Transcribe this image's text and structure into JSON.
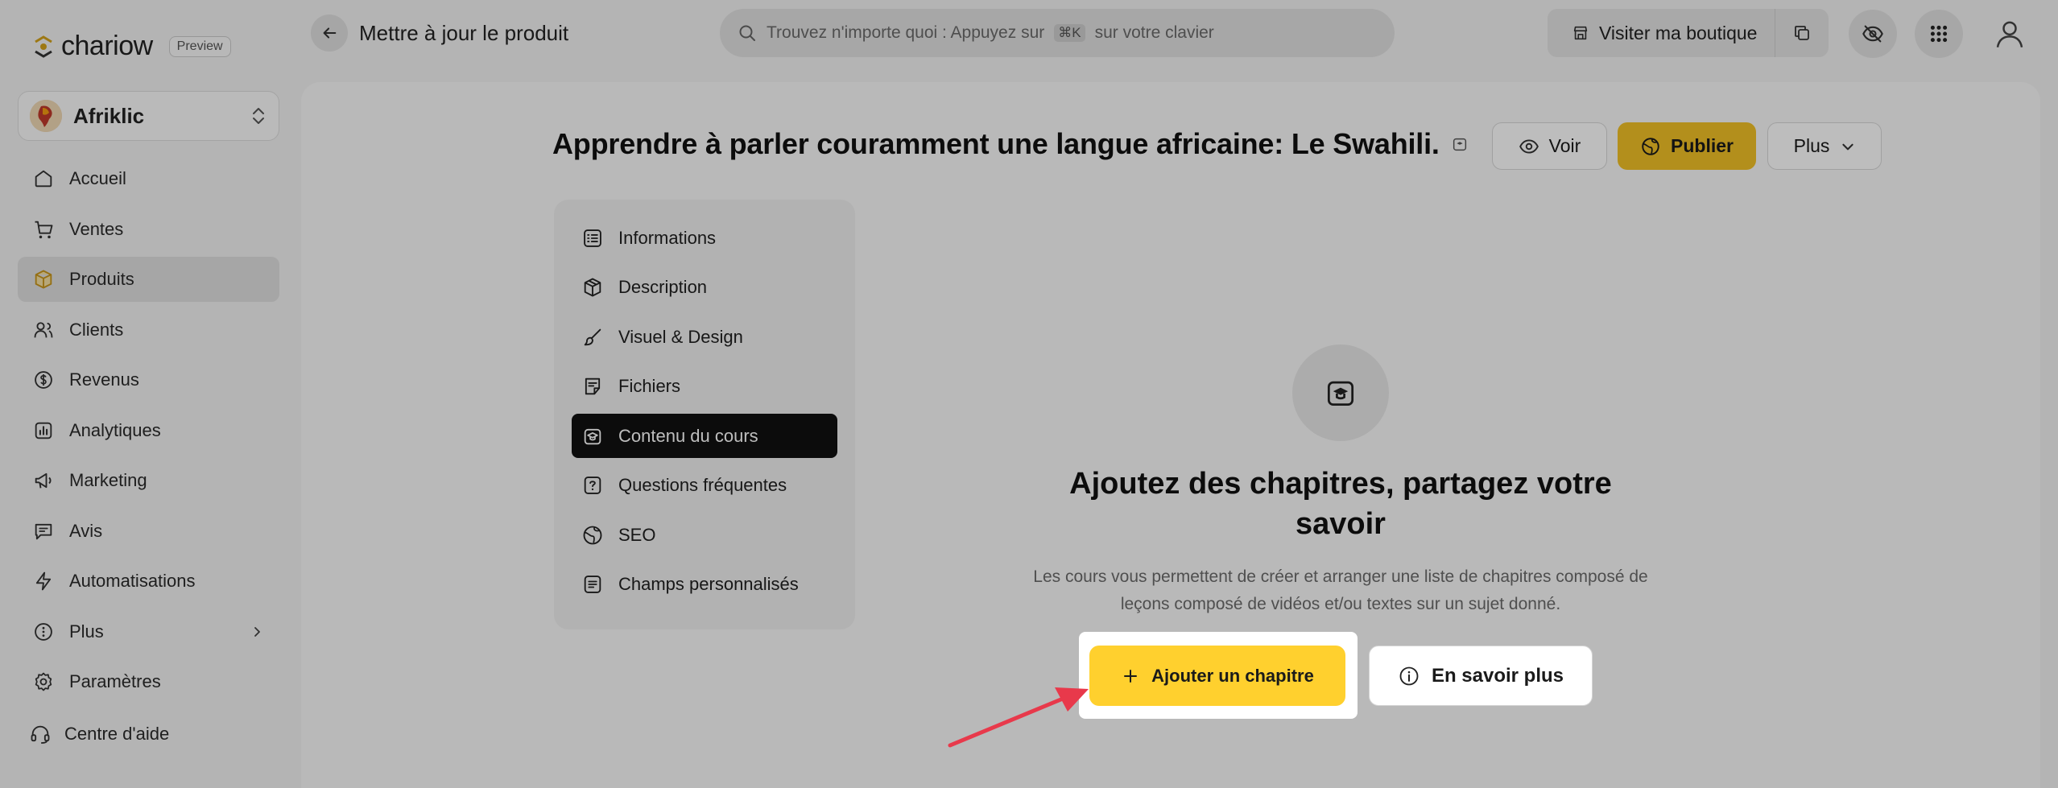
{
  "app": {
    "logo_text": "chariow",
    "preview_badge": "Preview",
    "page_title": "Mettre à jour le produit"
  },
  "search": {
    "text_before": "Trouvez n'importe quoi : Appuyez sur",
    "shortcut": "⌘K",
    "text_after": "sur votre clavier"
  },
  "topbar": {
    "visit_store_label": "Visiter ma boutique",
    "icons": [
      "store-icon",
      "copy-icon",
      "eye-off-icon",
      "apps-grid-icon",
      "user-icon"
    ]
  },
  "store": {
    "name": "Afriklic"
  },
  "sidebar": {
    "items": [
      {
        "label": "Accueil",
        "icon": "home-icon",
        "active": false
      },
      {
        "label": "Ventes",
        "icon": "cart-icon",
        "active": false
      },
      {
        "label": "Produits",
        "icon": "box-icon",
        "active": true
      },
      {
        "label": "Clients",
        "icon": "users-icon",
        "active": false
      },
      {
        "label": "Revenus",
        "icon": "dollar-icon",
        "active": false
      },
      {
        "label": "Analytiques",
        "icon": "chart-icon",
        "active": false
      },
      {
        "label": "Marketing",
        "icon": "megaphone-icon",
        "active": false
      },
      {
        "label": "Avis",
        "icon": "message-icon",
        "active": false
      },
      {
        "label": "Automatisations",
        "icon": "bolt-icon",
        "active": false
      },
      {
        "label": "Plus",
        "icon": "more-icon",
        "active": false
      },
      {
        "label": "Paramètres",
        "icon": "gear-icon",
        "active": false
      }
    ],
    "help_label": "Centre d'aide"
  },
  "product": {
    "title": "Apprendre à parler couramment une langue africaine: Le Swahili.",
    "voir_label": "Voir",
    "publier_label": "Publier",
    "plus_label": "Plus"
  },
  "tabs": [
    {
      "label": "Informations",
      "icon": "list-icon",
      "active": false
    },
    {
      "label": "Description",
      "icon": "cube-icon",
      "active": false
    },
    {
      "label": "Visuel & Design",
      "icon": "brush-icon",
      "active": false
    },
    {
      "label": "Fichiers",
      "icon": "file-icon",
      "active": false
    },
    {
      "label": "Contenu du cours",
      "icon": "course-icon",
      "active": true
    },
    {
      "label": "Questions fréquentes",
      "icon": "question-icon",
      "active": false
    },
    {
      "label": "SEO",
      "icon": "globe-icon",
      "active": false
    },
    {
      "label": "Champs personnalisés",
      "icon": "fields-icon",
      "active": false
    }
  ],
  "empty_state": {
    "title": "Ajoutez des chapitres, partagez votre savoir",
    "description": "Les cours vous permettent de créer et arranger une liste de chapitres composé de leçons composé de vidéos et/ou textes sur un sujet donné.",
    "add_chapter_label": "Ajouter un chapitre",
    "learn_more_label": "En savoir plus"
  },
  "colors": {
    "accent_yellow": "#ffd02e",
    "publish_yellow": "#f2c126",
    "annotation_arrow": "#e8394b",
    "active_tab_bg": "#111111"
  }
}
